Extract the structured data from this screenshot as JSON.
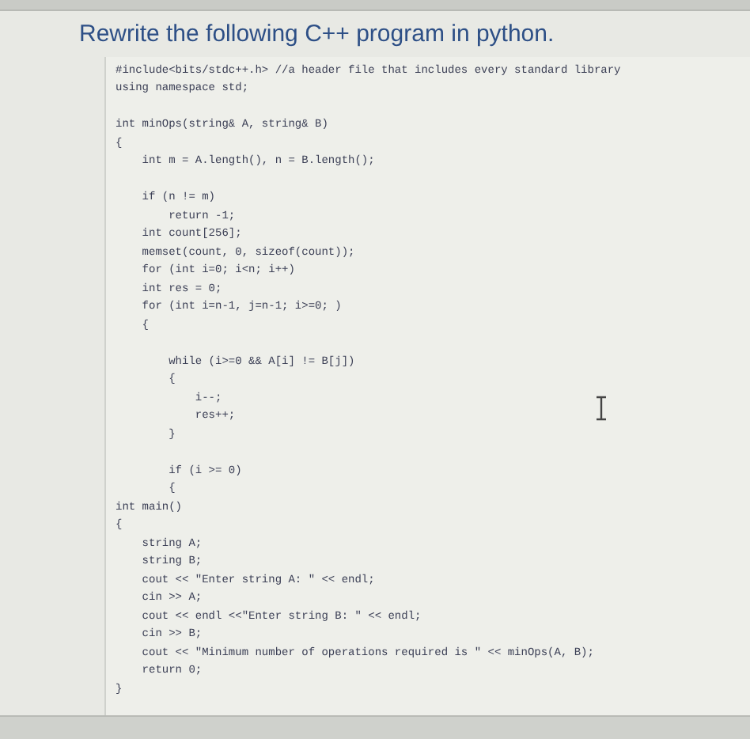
{
  "question": {
    "title": "Rewrite the following C++ program in python."
  },
  "code": [
    {
      "text": "#include<bits/stdc++.h> //a header file that includes every standard library",
      "blank_before": false
    },
    {
      "text": "using namespace std;",
      "blank_before": false
    },
    {
      "text": "int minOps(string& A, string& B)",
      "blank_before": true
    },
    {
      "text": "{",
      "blank_before": false
    },
    {
      "text": "    int m = A.length(), n = B.length();",
      "blank_before": false
    },
    {
      "text": "    if (n != m)",
      "blank_before": true
    },
    {
      "text": "        return -1;",
      "blank_before": false
    },
    {
      "text": "    int count[256];",
      "blank_before": false
    },
    {
      "text": "    memset(count, 0, sizeof(count));",
      "blank_before": false
    },
    {
      "text": "    for (int i=0; i<n; i++)",
      "blank_before": false
    },
    {
      "text": "    int res = 0;",
      "blank_before": false
    },
    {
      "text": "    for (int i=n-1, j=n-1; i>=0; )",
      "blank_before": false
    },
    {
      "text": "    {",
      "blank_before": false
    },
    {
      "text": "        while (i>=0 && A[i] != B[j])",
      "blank_before": true
    },
    {
      "text": "        {",
      "blank_before": false
    },
    {
      "text": "            i--;",
      "blank_before": false
    },
    {
      "text": "            res++;",
      "blank_before": false
    },
    {
      "text": "        }",
      "blank_before": false
    },
    {
      "text": "        if (i >= 0)",
      "blank_before": true
    },
    {
      "text": "        {",
      "blank_before": false
    },
    {
      "text": "int main()",
      "blank_before": false
    },
    {
      "text": "{",
      "blank_before": false
    },
    {
      "text": "    string A;",
      "blank_before": false
    },
    {
      "text": "    string B;",
      "blank_before": false
    },
    {
      "text": "    cout << \"Enter string A: \" << endl;",
      "blank_before": false
    },
    {
      "text": "    cin >> A;",
      "blank_before": false
    },
    {
      "text": "    cout << endl <<\"Enter string B: \" << endl;",
      "blank_before": false
    },
    {
      "text": "    cin >> B;",
      "blank_before": false
    },
    {
      "text": "    cout << \"Minimum number of operations required is \" << minOps(A, B);",
      "blank_before": false
    },
    {
      "text": "    return 0;",
      "blank_before": false
    },
    {
      "text": "}",
      "blank_before": false
    }
  ]
}
